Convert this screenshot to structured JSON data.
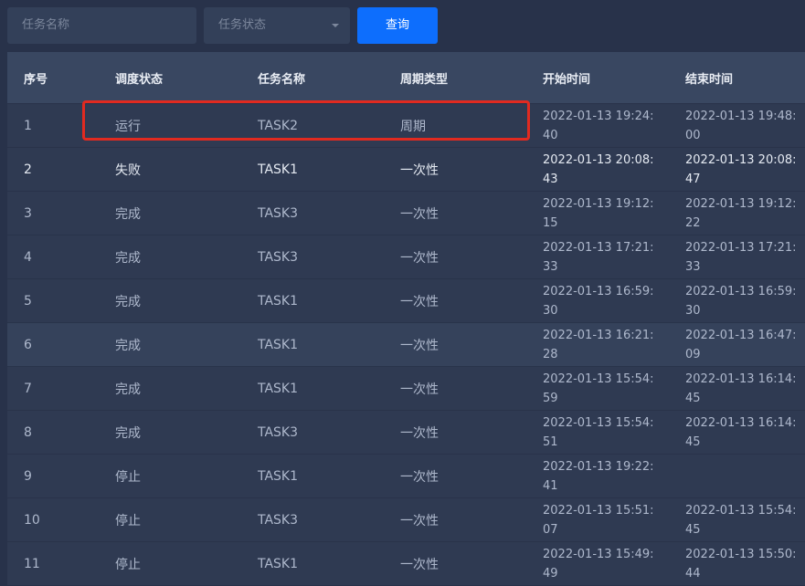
{
  "filters": {
    "task_name_placeholder": "任务名称",
    "status_placeholder": "任务状态",
    "query_label": "查询"
  },
  "table": {
    "headers": [
      "序号",
      "调度状态",
      "任务名称",
      "周期类型",
      "开始时间",
      "结束时间"
    ],
    "rows": [
      {
        "no": "1",
        "status": "运行",
        "task": "TASK2",
        "cycle": "周期",
        "start": "2022-01-13 19:24:40",
        "end": "2022-01-13 19:48:00"
      },
      {
        "no": "2",
        "status": "失败",
        "task": "TASK1",
        "cycle": "一次性",
        "start": "2022-01-13 20:08:43",
        "end": "2022-01-13 20:08:47"
      },
      {
        "no": "3",
        "status": "完成",
        "task": "TASK3",
        "cycle": "一次性",
        "start": "2022-01-13 19:12:15",
        "end": "2022-01-13 19:12:22"
      },
      {
        "no": "4",
        "status": "完成",
        "task": "TASK3",
        "cycle": "一次性",
        "start": "2022-01-13 17:21:33",
        "end": "2022-01-13 17:21:33"
      },
      {
        "no": "5",
        "status": "完成",
        "task": "TASK1",
        "cycle": "一次性",
        "start": "2022-01-13 16:59:30",
        "end": "2022-01-13 16:59:30"
      },
      {
        "no": "6",
        "status": "完成",
        "task": "TASK1",
        "cycle": "一次性",
        "start": "2022-01-13 16:21:28",
        "end": "2022-01-13 16:47:09"
      },
      {
        "no": "7",
        "status": "完成",
        "task": "TASK1",
        "cycle": "一次性",
        "start": "2022-01-13 15:54:59",
        "end": "2022-01-13 16:14:45"
      },
      {
        "no": "8",
        "status": "完成",
        "task": "TASK3",
        "cycle": "一次性",
        "start": "2022-01-13 15:54:51",
        "end": "2022-01-13 16:14:45"
      },
      {
        "no": "9",
        "status": "停止",
        "task": "TASK1",
        "cycle": "一次性",
        "start": "2022-01-13 19:22:41",
        "end": ""
      },
      {
        "no": "10",
        "status": "停止",
        "task": "TASK3",
        "cycle": "一次性",
        "start": "2022-01-13 15:51:07",
        "end": "2022-01-13 15:54:45"
      },
      {
        "no": "11",
        "status": "停止",
        "task": "TASK1",
        "cycle": "一次性",
        "start": "2022-01-13 15:49:49",
        "end": "2022-01-13 15:50:44"
      }
    ]
  },
  "colors": {
    "background": "#28324a",
    "header": "#394761",
    "accent": "#0d6efd",
    "highlight_border": "#e12a20"
  }
}
